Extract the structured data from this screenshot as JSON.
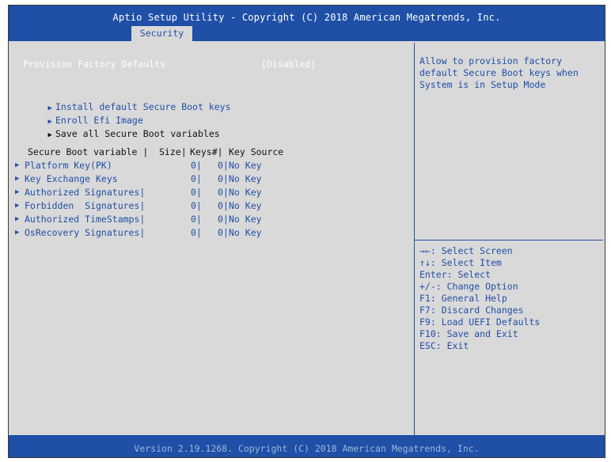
{
  "header": {
    "title": "Aptio Setup Utility - Copyright (C) 2018 American Megatrends, Inc.",
    "active_tab": "Security"
  },
  "main": {
    "provision": {
      "label": "Provision Factory Defaults",
      "value": "[Disabled]"
    },
    "actions": [
      {
        "label": "Install default Secure Boot keys"
      },
      {
        "label": "Enroll Efi Image"
      },
      {
        "label": "Save all Secure Boot variables"
      }
    ],
    "table": {
      "headers": [
        "Secure Boot variable |",
        "Size|",
        "Keys#|",
        "Key Source"
      ],
      "rows": [
        {
          "name": "Platform Key(PK)",
          "size": "0|",
          "keys": "0|",
          "source": "No Key"
        },
        {
          "name": "Key Exchange Keys",
          "size": "0|",
          "keys": "0|",
          "source": "No Key"
        },
        {
          "name": "Authorized Signatures|",
          "size": "0|",
          "keys": "0|",
          "source": "No Key"
        },
        {
          "name": "Forbidden  Signatures|",
          "size": "0|",
          "keys": "0|",
          "source": "No Key"
        },
        {
          "name": "Authorized TimeStamps|",
          "size": "0|",
          "keys": "0|",
          "source": "No Key"
        },
        {
          "name": "OsRecovery Signatures|",
          "size": "0|",
          "keys": "0|",
          "source": "No Key"
        }
      ]
    }
  },
  "side": {
    "help": "Allow to provision factory default Secure Boot keys when System is in Setup Mode",
    "keys": [
      "→←: Select Screen",
      "↑↓: Select Item",
      "Enter: Select",
      "+/-: Change Option",
      "F1: General Help",
      "F7: Discard Changes",
      "F9: Load UEFI Defaults",
      "F10: Save and Exit",
      "ESC: Exit"
    ]
  },
  "footer": {
    "text": "Version 2.19.1268. Copyright (C) 2018 American Megatrends, Inc."
  },
  "colors": {
    "bios_blue": "#1f4fa6",
    "background_gray": "#d9d9d9",
    "highlight_white": "#ffffff"
  },
  "icons": {
    "submenu": "triangle-right-icon"
  }
}
